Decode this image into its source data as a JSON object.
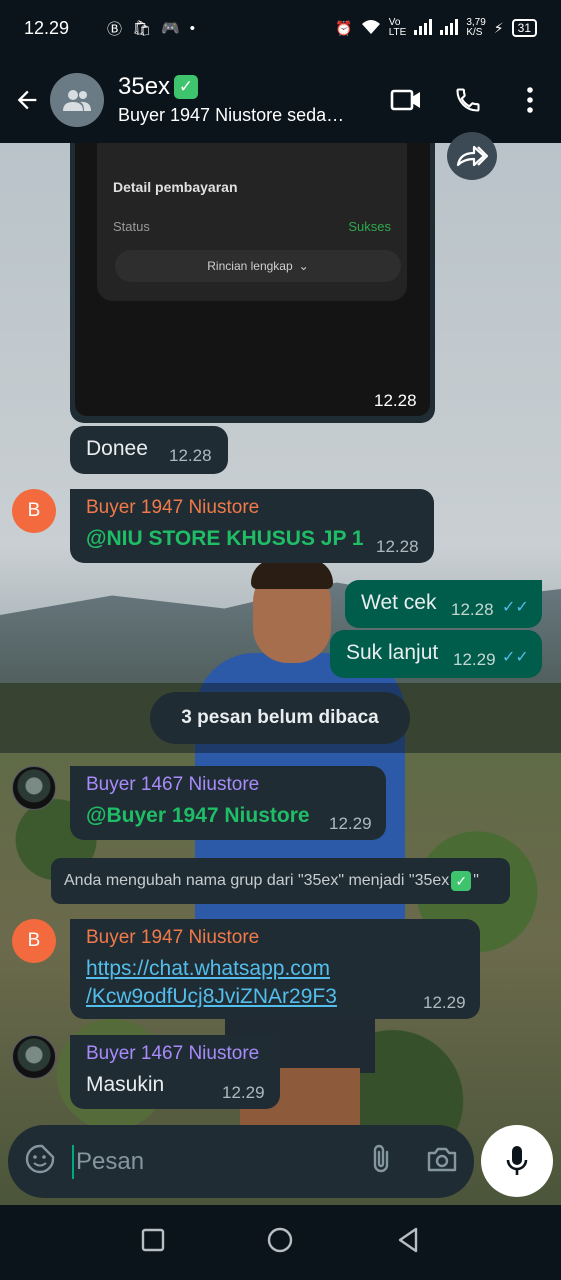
{
  "status_bar": {
    "time": "12.29",
    "icons_left": [
      "bip-icon",
      "shopee-icon",
      "game-icon",
      "dot"
    ],
    "network_speed": "3,79\nK/S",
    "battery": "31"
  },
  "header": {
    "title": "35ex",
    "subtitle": "Buyer 1947 Niustore seda…"
  },
  "receipt": {
    "heading": "Detail pembayaran",
    "status_label": "Status",
    "status_value": "Sukses",
    "details_button": "Rincian lengkap",
    "time": "12.28"
  },
  "messages": [
    {
      "type": "out-image-tail",
      "text": "Donee",
      "time": "12.28"
    },
    {
      "sender": "Buyer 1947 Niustore",
      "text": "@NIU STORE KHUSUS JP 1",
      "time": "12.28",
      "avatar": "B"
    },
    {
      "text": "Wet cek",
      "time": "12.28"
    },
    {
      "text": "Suk lanjut",
      "time": "12.29"
    },
    {
      "sender": "Buyer 1467 Niustore",
      "text": "@Buyer 1947 Niustore",
      "time": "12.29"
    },
    {
      "sender": "Buyer 1947 Niustore",
      "link_line1": "https://chat.whatsapp.com",
      "link_line2": "/Kcw9odfUcj8JviZNAr29F3",
      "time": "12.29",
      "avatar": "B"
    },
    {
      "sender": "Buyer 1467 Niustore",
      "text": "Masukin",
      "time": "12.29"
    }
  ],
  "unread_banner": "3 pesan belum dibaca",
  "system_message": {
    "prefix": "Anda mengubah nama grup dari \"35ex\" menjadi \"35ex",
    "suffix": "\""
  },
  "input": {
    "placeholder": "Pesan"
  },
  "colors": {
    "incoming_bubble": "#202c33",
    "outgoing_bubble": "#005c4b",
    "accent_green": "#00a884",
    "read_ticks": "#53bdeb"
  }
}
